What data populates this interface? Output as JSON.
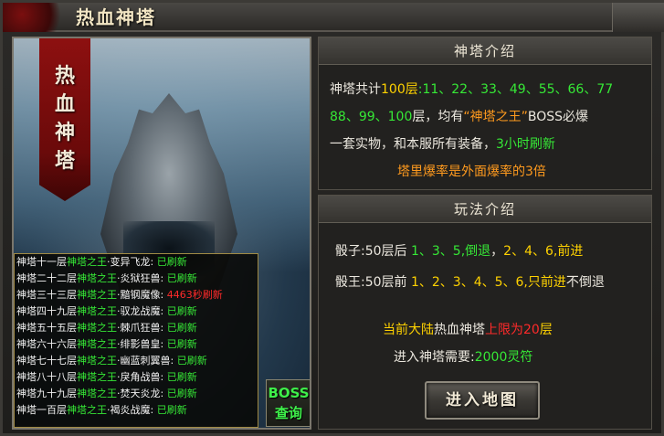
{
  "window": {
    "title": "热血神塔"
  },
  "art": {
    "banner_text": "热\n血\n神\n塔"
  },
  "boss_list": {
    "rows": [
      {
        "floor": "神塔十一层",
        "king": "神塔之王",
        "name": "·变异飞龙: ",
        "status": "已刷新",
        "is_timer": false
      },
      {
        "floor": "神塔二十二层",
        "king": "神塔之王",
        "name": "·炎狱狂兽: ",
        "status": "已刷新",
        "is_timer": false
      },
      {
        "floor": "神塔三十三层",
        "king": "神塔之王",
        "name": "·黯钢魔像: ",
        "status": "4463秒刷新",
        "is_timer": true
      },
      {
        "floor": "神塔四十九层",
        "king": "神塔之王",
        "name": "·驭龙战魔: ",
        "status": "已刷新",
        "is_timer": false
      },
      {
        "floor": "神塔五十五层",
        "king": "神塔之王",
        "name": "·棘爪狂兽: ",
        "status": "已刷新",
        "is_timer": false
      },
      {
        "floor": "神塔六十六层",
        "king": "神塔之王",
        "name": "·绯影兽皇: ",
        "status": "已刷新",
        "is_timer": false
      },
      {
        "floor": "神塔七十七层",
        "king": "神塔之王",
        "name": "·幽蓝刺翼兽: ",
        "status": "已刷新",
        "is_timer": false
      },
      {
        "floor": "神塔八十八层",
        "king": "神塔之王",
        "name": "·戾角战兽: ",
        "status": "已刷新",
        "is_timer": false
      },
      {
        "floor": "神塔九十九层",
        "king": "神塔之王",
        "name": "·焚天炎龙: ",
        "status": "已刷新",
        "is_timer": false
      },
      {
        "floor": "神塔一百层",
        "king": "神塔之王",
        "name": "·褐炎战魔: ",
        "status": "已刷新",
        "is_timer": false
      }
    ],
    "query_button": {
      "line1": "BOSS",
      "line2": "查询"
    }
  },
  "tower_intro": {
    "header": "神塔介绍",
    "line1": {
      "a": "神塔共计",
      "b": "100层",
      "c": ":11、22、33、49、55、66、77"
    },
    "line2": {
      "a": "88、99、100",
      "b": "层，均有",
      "c": "“神塔之王”",
      "d": "BOSS必爆"
    },
    "line3": {
      "a": "一套实物，和本服所有装备，",
      "b": "3小时刷新"
    },
    "line4": "塔里爆率是外面爆率的3倍"
  },
  "gameplay": {
    "header": "玩法介绍",
    "dice1": {
      "a": "骰子:50层后 ",
      "b": "1、3、5,",
      "c": "倒退",
      "d": "，",
      "e": "2、4、6,",
      "f": "前进"
    },
    "dice2": {
      "a": "骰王:50层前 ",
      "b": "1、2、3、4、5、6,",
      "c": "只前进",
      "d": "不倒退"
    },
    "limit": {
      "a": "当前大陆",
      "b": "热血神塔",
      "c": "上限为20",
      "d": "层"
    },
    "cost": {
      "a": "进入神塔需要:",
      "b": "2000灵符"
    },
    "enter_button": "进入地图"
  },
  "colors": {
    "accent_yellow": "#ffd200",
    "accent_green": "#36e836",
    "accent_orange": "#ff9a1e",
    "accent_red": "#ff2a2a"
  }
}
